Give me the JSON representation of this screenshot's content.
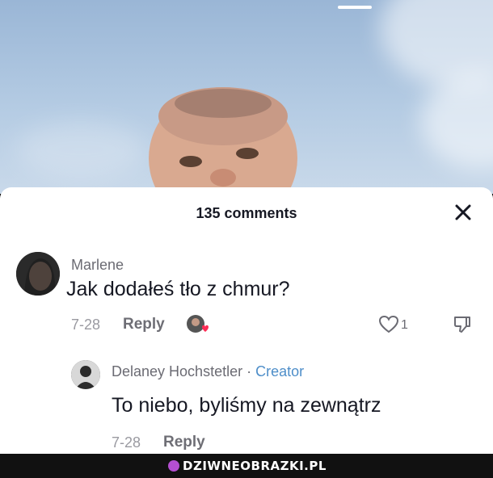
{
  "comments_panel": {
    "count_label": "135 comments"
  },
  "comment": {
    "username": "Marlene",
    "text": "Jak dodałeś tło z chmur?",
    "date": "7-28",
    "reply_label": "Reply",
    "like_count": "1"
  },
  "reply": {
    "username": "Delaney Hochstetler",
    "separator": " · ",
    "badge": "Creator",
    "text": "To niebo, byliśmy na zewnątrz",
    "date": "7-28",
    "reply_label": "Reply"
  },
  "watermark": {
    "text": "DZIWNEOBRAZKI.PL"
  },
  "icons": [
    "close-icon",
    "creator-liked-avatar-icon",
    "heart-icon",
    "dislike-icon"
  ],
  "colors": {
    "sky": "#b4cbe3",
    "panel": "#ffffff",
    "creator_badge": "#4e8ec9",
    "liked_heart": "#fe2c55",
    "watermark_dot": "#b44fd1"
  }
}
